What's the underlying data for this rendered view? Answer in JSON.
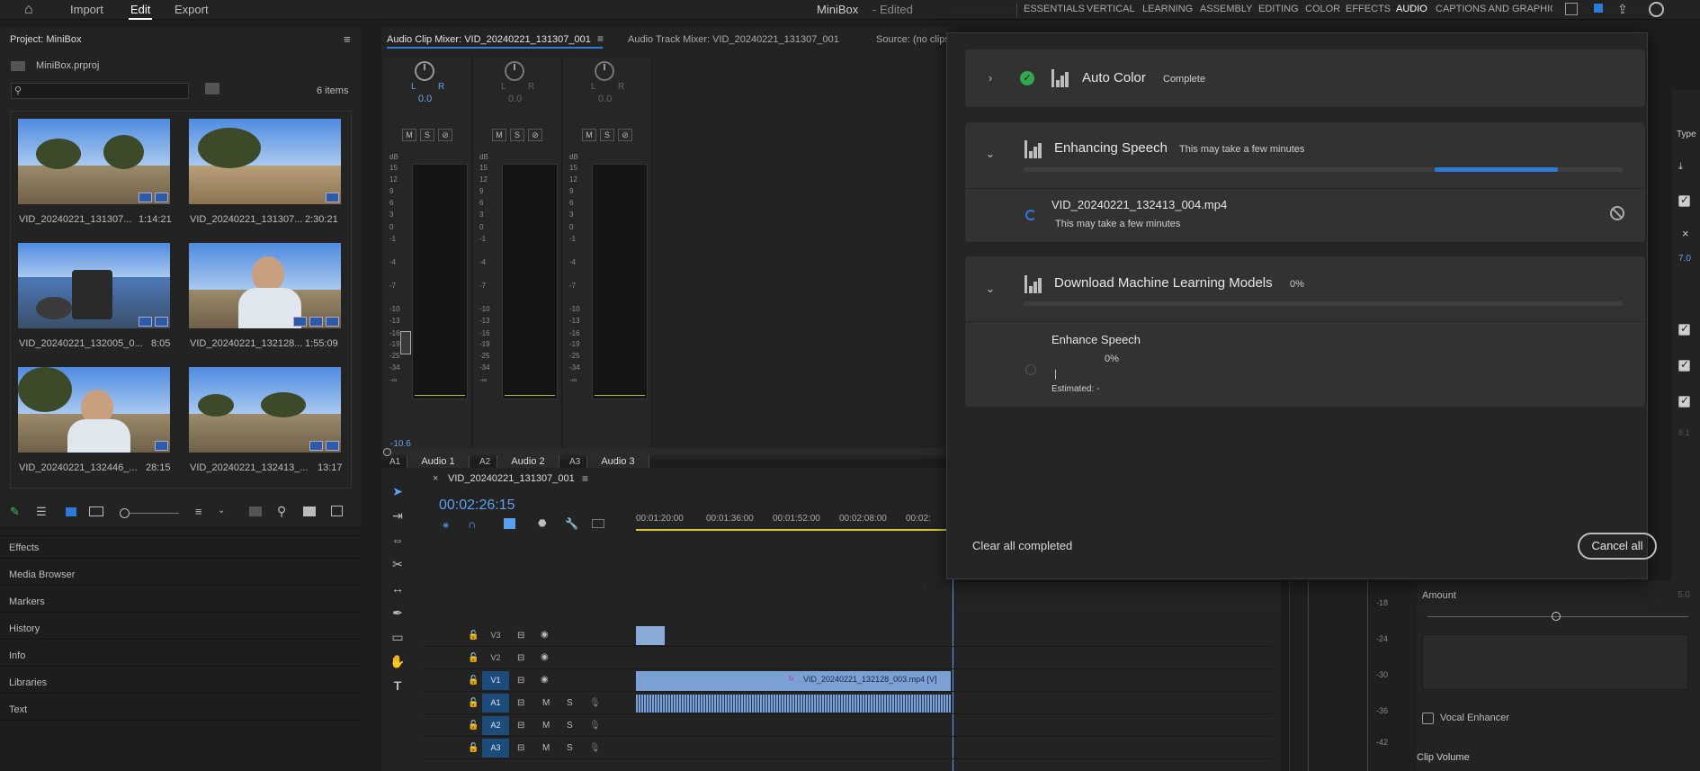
{
  "app": {
    "title": "MiniBox",
    "title_suffix": "- Edited",
    "nav": {
      "import": "Import",
      "edit": "Edit",
      "export": "Export"
    },
    "workspaces": [
      "ESSENTIALS",
      "VERTICAL",
      "LEARNING",
      "ASSEMBLY",
      "EDITING",
      "COLOR",
      "EFFECTS",
      "AUDIO",
      "CAPTIONS AND GRAPHICS"
    ],
    "active_workspace": "AUDIO",
    "accent": "#2d7ad7"
  },
  "project": {
    "title": "Project: MiniBox",
    "file": "MiniBox.prproj",
    "count": "6 items",
    "clips": [
      {
        "name": "VID_20240221_131307...",
        "duration": "1:14:21"
      },
      {
        "name": "VID_20240221_131307...",
        "duration": "2:30:21"
      },
      {
        "name": "VID_20240221_132005_0...",
        "duration": "8:05"
      },
      {
        "name": "VID_20240221_132128...",
        "duration": "1:55:09"
      },
      {
        "name": "VID_20240221_132446_...",
        "duration": "28:15"
      },
      {
        "name": "VID_20240221_132413_...",
        "duration": "13:17"
      }
    ]
  },
  "left_panels": [
    "Effects",
    "Media Browser",
    "Markers",
    "History",
    "Info",
    "Libraries",
    "Text"
  ],
  "mixer": {
    "tabs": {
      "clip_mixer": "Audio Clip Mixer: VID_20240221_131307_001",
      "track_mixer": "Audio Track Mixer: VID_20240221_131307_001",
      "source": "Source: (no clips)"
    },
    "channels": [
      {
        "id": "A1",
        "name": "Audio 1",
        "pan_value": "0.0",
        "fader_readout": "-10.6"
      },
      {
        "id": "A2",
        "name": "Audio 2",
        "pan_value": "0.0"
      },
      {
        "id": "A3",
        "name": "Audio 3",
        "pan_value": "0.0"
      }
    ],
    "db_scale": [
      "dB",
      "15",
      "12",
      "9",
      "6",
      "3",
      "0",
      "-1",
      "-4",
      "-7",
      "-10",
      "-13",
      "-16",
      "-19",
      "-25",
      "-34",
      "-∞"
    ],
    "mss": [
      "M",
      "S",
      "⊘"
    ],
    "pan_labels": {
      "left": "L",
      "right": "R"
    }
  },
  "timeline": {
    "sequence": "VID_20240221_131307_001",
    "timecode": "00:02:26:15",
    "ruler": [
      "00:01:20:00",
      "00:01:36:00",
      "00:01:52:00",
      "00:02:08:00",
      "00:02:"
    ],
    "tracks": [
      "V3",
      "V2",
      "V1",
      "A1",
      "A2",
      "A3"
    ],
    "clip_label": "VID_20240221_132128_003.mp4 [V]",
    "fx_label": "fx",
    "track_ctrl": {
      "mute": "M",
      "solo": "S"
    },
    "right_scale": [
      "-18",
      "-24",
      "-30",
      "-36",
      "-42"
    ]
  },
  "progress": {
    "items": [
      {
        "title": "Auto Color",
        "status": "Complete",
        "done": true
      },
      {
        "title": "Enhancing Speech",
        "status": "This may take a few minutes",
        "progress": 0.23,
        "sub": {
          "file": "VID_20240221_132413_004.mp4",
          "note": "This may take a few minutes"
        }
      },
      {
        "title": "Download Machine Learning Models",
        "status": "0%",
        "sub": {
          "file": "Enhance Speech",
          "percent": "0%",
          "cursor": "|",
          "estimated": "Estimated: -"
        }
      }
    ],
    "clear_label": "Clear all completed",
    "cancel_label": "Cancel all"
  },
  "essential_sound": {
    "type_label": "Type",
    "value_a": "7.0",
    "value_b": "8.1",
    "amount_label": "Amount",
    "amount_value": "5.0",
    "vocal_enhancer": "Vocal Enhancer",
    "clip_volume": "Clip Volume"
  }
}
